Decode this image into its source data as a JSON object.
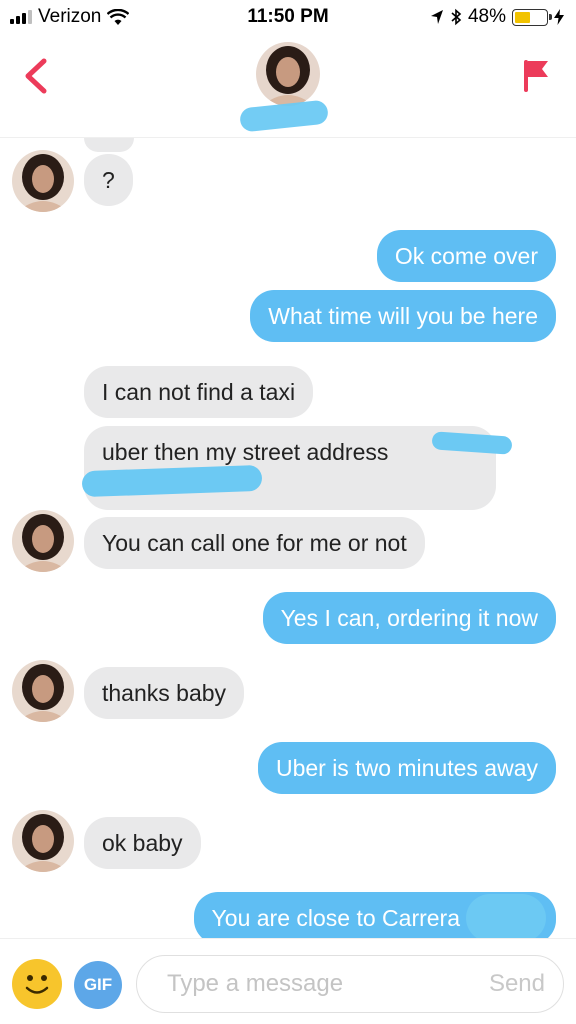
{
  "status_bar": {
    "carrier": "Verizon",
    "time": "11:50 PM",
    "battery": "48%"
  },
  "colors": {
    "accent": "#5fbef3",
    "incoming_bubble": "#e9e9ea",
    "flag": "#ec3b5a",
    "gif": "#5da7e8",
    "emoji": "#f7c52c"
  },
  "header": {
    "back_icon": "chevron-left-icon",
    "report_icon": "flag-icon"
  },
  "messages": [
    {
      "dir": "in",
      "text": "?"
    },
    {
      "dir": "out",
      "text": "Ok come over"
    },
    {
      "dir": "out",
      "text": "What time will you be here"
    },
    {
      "dir": "in",
      "text": "I can not find a taxi"
    },
    {
      "dir": "in",
      "text": "uber then my street address"
    },
    {
      "dir": "in",
      "text": "You can call one for me or not"
    },
    {
      "dir": "out",
      "text": "Yes I can, ordering it now"
    },
    {
      "dir": "in",
      "text": "thanks baby"
    },
    {
      "dir": "out",
      "text": "Uber is two minutes away"
    },
    {
      "dir": "in",
      "text": "ok baby"
    },
    {
      "dir": "out",
      "text": "You are close to Carrera"
    }
  ],
  "composer": {
    "gif_label": "GIF",
    "placeholder": "Type a message",
    "send_label": "Send"
  }
}
